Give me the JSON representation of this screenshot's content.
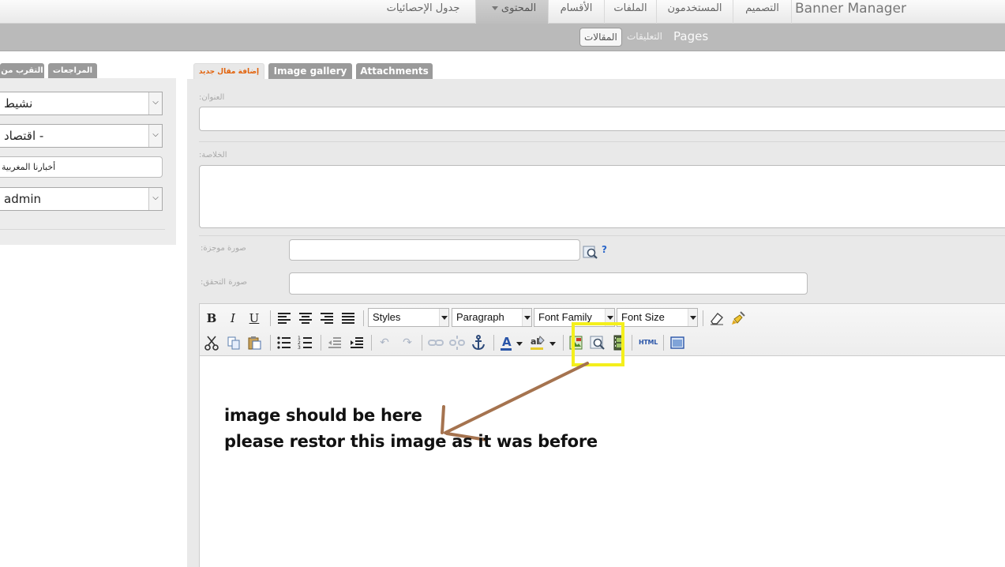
{
  "topnav": {
    "items": [
      {
        "label": "جدول الإحصائيات"
      },
      {
        "label": "المحتوى",
        "active": true
      },
      {
        "label": "الأقسام"
      },
      {
        "label": "الملفات"
      },
      {
        "label": "المستخدمون"
      },
      {
        "label": "التصميم"
      },
      {
        "label": "Banner Manager"
      }
    ]
  },
  "subnav": {
    "items": [
      {
        "label": "المقالات",
        "active": true
      },
      {
        "label": "التعليقات"
      },
      {
        "label": "Pages"
      }
    ]
  },
  "sidebar": {
    "tabs": [
      {
        "label": "التقرب من"
      },
      {
        "label": "المراجعات"
      }
    ],
    "status_value": "نشيط",
    "category_value": "اقتصاد -",
    "source_value": "أخبارنا المغربية",
    "author_value": "admin"
  },
  "main_tabs": [
    {
      "label": "إضافة مقال جديد",
      "active": true
    },
    {
      "label": "Image gallery"
    },
    {
      "label": "Attachments"
    }
  ],
  "form": {
    "title_label": ":العنوان",
    "summary_label": ":الخلاصة",
    "thumb_label": ":صورة موجزة",
    "verify_label": ":صورة التحقق",
    "help_mark": "?"
  },
  "editor": {
    "styles_value": "Styles",
    "format_value": "Paragraph",
    "font_family_value": "Font Family",
    "font_size_value": "Font Size",
    "bold": "B",
    "italic": "I",
    "underline": "U",
    "html_label": "HTML"
  },
  "annotation": {
    "line1": "image should be here",
    "line2": "please restor this image as it  was before",
    "highlight_color": "#f4ef1c",
    "arrow_color": "#a5734f"
  }
}
